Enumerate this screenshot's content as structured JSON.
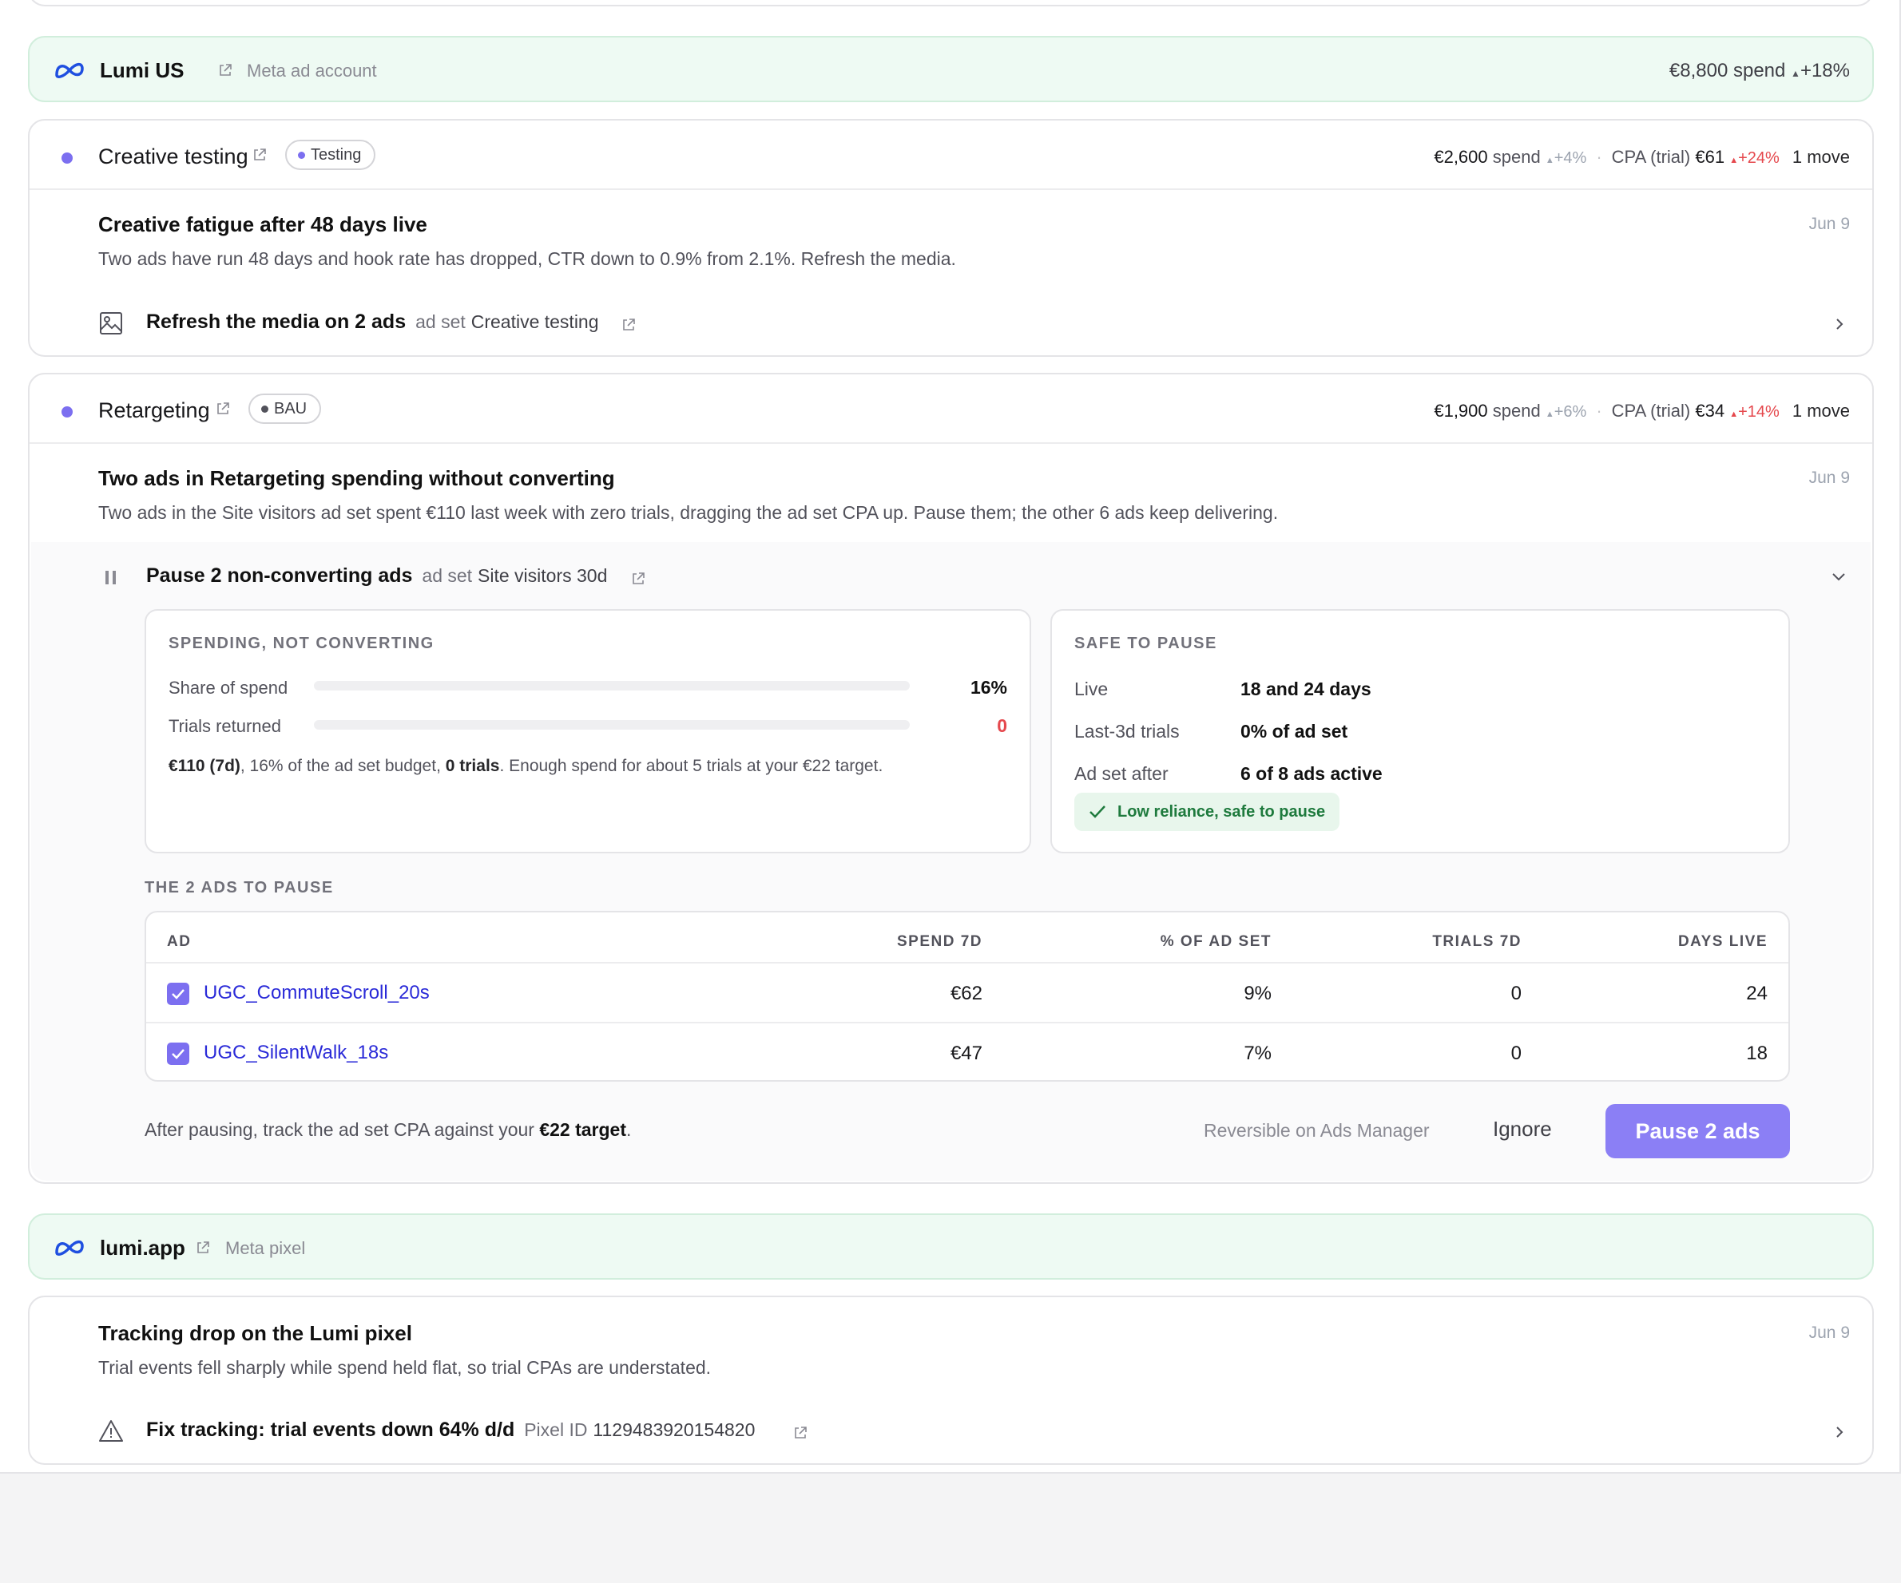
{
  "accounts": [
    {
      "name": "Lumi US",
      "kind": "Meta ad account",
      "spend": "€8,800 spend",
      "delta": "+18%"
    },
    {
      "name": "lumi.app",
      "kind": "Meta pixel"
    }
  ],
  "adsets": [
    {
      "name": "Creative testing",
      "badge": "Testing",
      "spend": "€2,600",
      "spend_label": "spend",
      "spend_delta": "+4%",
      "cpa_label": "CPA (trial)",
      "cpa": "€61",
      "cpa_delta": "+24%",
      "moves": "1 move",
      "insight": {
        "title": "Creative fatigue after 48 days live",
        "date": "Jun 9",
        "body": "Two ads have run 48 days and hook rate has dropped, CTR down to 0.9% from 2.1%. Refresh the media.",
        "action": "Refresh the media on 2 ads",
        "action_sub": "ad set",
        "action_target": "Creative testing",
        "icon": "image-icon"
      }
    },
    {
      "name": "Retargeting",
      "badge": "BAU",
      "spend": "€1,900",
      "spend_label": "spend",
      "spend_delta": "+6%",
      "cpa_label": "CPA (trial)",
      "cpa": "€34",
      "cpa_delta": "+14%",
      "moves": "1 move",
      "insight": {
        "title": "Two ads in Retargeting spending without converting",
        "date": "Jun 9",
        "body": "Two ads in the Site visitors ad set spent €110 last week with zero trials, dragging the ad set CPA up. Pause them; the other 6 ads keep delivering.",
        "action": "Pause 2 non-converting ads",
        "action_sub": "ad set",
        "action_target": "Site visitors 30d",
        "icon": "pause-icon"
      }
    }
  ],
  "detail": {
    "spending": {
      "heading": "SPENDING, NOT CONVERTING",
      "share_label": "Share of spend",
      "share_value": "16%",
      "share_fraction": 0.0,
      "trials_label": "Trials returned",
      "trials_value": "0",
      "note_spend": "€110 (7d)",
      "note_mid": ", 16% of the ad set budget, ",
      "note_trials": "0 trials",
      "note_end": ". Enough spend for about 5 trials at your €22 target."
    },
    "safe": {
      "heading": "SAFE TO PAUSE",
      "rows": [
        {
          "k": "Live",
          "v": "18 and 24 days"
        },
        {
          "k": "Last-3d trials",
          "v": "0% of ad set"
        },
        {
          "k": "Ad set after",
          "v": "6 of 8 ads active"
        }
      ],
      "verdict": "Low reliance, safe to pause"
    },
    "table_heading": "THE 2 ADS TO PAUSE",
    "columns": [
      "AD",
      "SPEND 7D",
      "% OF AD SET",
      "TRIALS 7D",
      "DAYS LIVE"
    ],
    "rows": [
      {
        "ad": "UGC_CommuteScroll_20s",
        "spend": "€62",
        "pct": "9%",
        "trials": "0",
        "days": "24",
        "checked": true
      },
      {
        "ad": "UGC_SilentWalk_18s",
        "spend": "€47",
        "pct": "7%",
        "trials": "0",
        "days": "18",
        "checked": true
      }
    ],
    "footer_pre": "After pausing, track the ad set CPA against your ",
    "footer_bold": "€22 target",
    "footer_post": ".",
    "reversible": "Reversible on Ads Manager",
    "ignore": "Ignore",
    "primary": "Pause 2 ads"
  },
  "pixel_insight": {
    "title": "Tracking drop on the Lumi pixel",
    "date": "Jun 9",
    "body": "Trial events fell sharply while spend held flat, so trial CPAs are understated.",
    "action": "Fix tracking: trial events down 64% d/d",
    "action_sub": "Pixel ID",
    "action_target": "1129483920154820",
    "icon": "warning-icon"
  },
  "colors": {
    "accent": "#7c6ff0",
    "primary_button": "#8b7ff5",
    "negative": "#e5484d",
    "positive_bg": "#e8f6ec",
    "link": "#2a2ad8",
    "account_bg": "#eefaf3"
  }
}
